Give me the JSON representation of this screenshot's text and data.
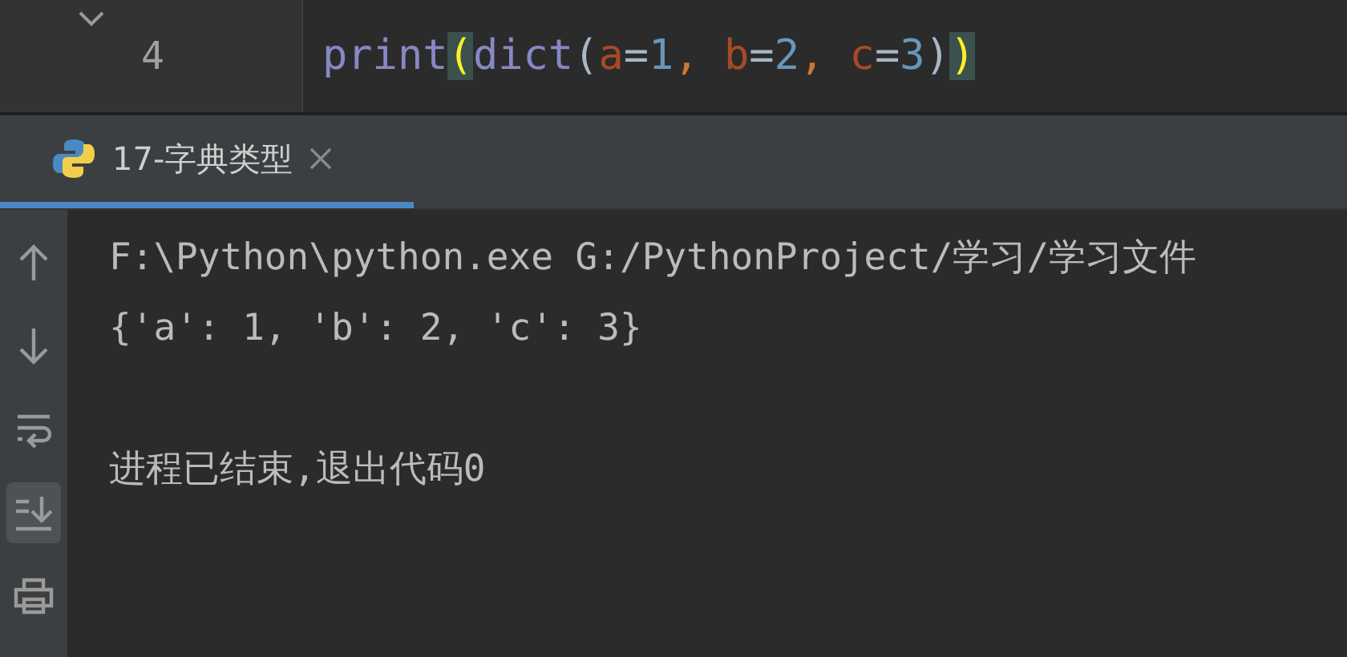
{
  "editor": {
    "lines": [
      {
        "number": "4",
        "tokens": [
          {
            "text": "print",
            "kind": "builtin"
          },
          {
            "text": "(",
            "kind": "match"
          },
          {
            "text": "dict",
            "kind": "builtin"
          },
          {
            "text": "(",
            "kind": "plain"
          },
          {
            "text": "a",
            "kind": "param"
          },
          {
            "text": "=",
            "kind": "plain"
          },
          {
            "text": "1",
            "kind": "number"
          },
          {
            "text": ", ",
            "kind": "comma"
          },
          {
            "text": "b",
            "kind": "param"
          },
          {
            "text": "=",
            "kind": "plain"
          },
          {
            "text": "2",
            "kind": "number"
          },
          {
            "text": ", ",
            "kind": "comma"
          },
          {
            "text": "c",
            "kind": "param"
          },
          {
            "text": "=",
            "kind": "plain"
          },
          {
            "text": "3",
            "kind": "number"
          },
          {
            "text": ")",
            "kind": "plain"
          },
          {
            "text": ")",
            "kind": "match"
          }
        ]
      }
    ]
  },
  "run_tabs": [
    {
      "label": "17-字典类型",
      "selected": true
    }
  ],
  "toolbar": [
    {
      "kind": "up",
      "selected": false
    },
    {
      "kind": "down",
      "selected": false
    },
    {
      "kind": "wrap",
      "selected": false
    },
    {
      "kind": "scroll-end",
      "selected": true
    },
    {
      "kind": "print",
      "selected": false
    }
  ],
  "console": {
    "blocks": [
      [
        "F:\\Python\\python.exe G:/PythonProject/学习/学习文件",
        "{'a': 1, 'b': 2, 'c': 3}"
      ],
      [
        "进程已结束,退出代码0"
      ]
    ]
  }
}
